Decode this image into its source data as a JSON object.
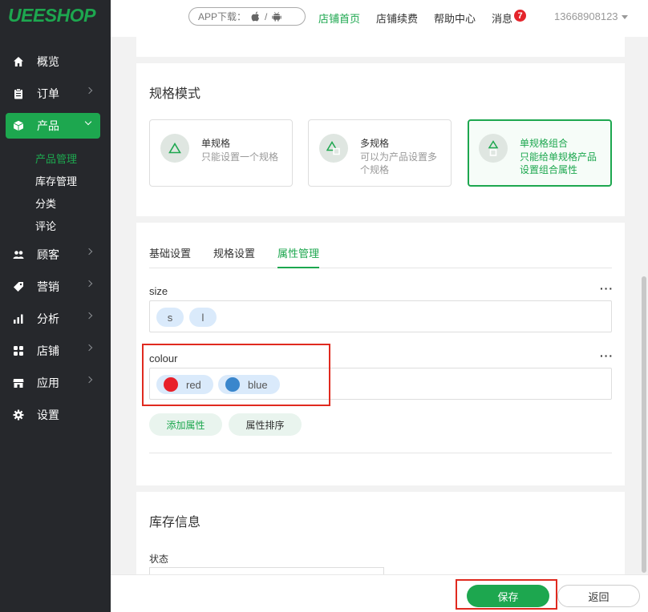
{
  "app": {
    "logo": "UEESHOP"
  },
  "sidebar": {
    "items": [
      {
        "label": "概览",
        "icon": "home-icon"
      },
      {
        "label": "订单",
        "icon": "clipboard-icon"
      },
      {
        "label": "产品",
        "icon": "box-icon"
      },
      {
        "label": "顾客",
        "icon": "users-icon"
      },
      {
        "label": "营销",
        "icon": "tag-icon"
      },
      {
        "label": "分析",
        "icon": "bar-chart-icon"
      },
      {
        "label": "店铺",
        "icon": "grid-icon"
      },
      {
        "label": "应用",
        "icon": "store-icon"
      },
      {
        "label": "设置",
        "icon": "gear-icon"
      }
    ],
    "sub_items": [
      {
        "label": "产品管理"
      },
      {
        "label": "库存管理"
      },
      {
        "label": "分类"
      },
      {
        "label": "评论"
      }
    ]
  },
  "header": {
    "app_download": "APP下载：",
    "slash": "/",
    "links": [
      {
        "label": "店铺首页"
      },
      {
        "label": "店铺续费"
      },
      {
        "label": "帮助中心"
      },
      {
        "label": "消息"
      }
    ],
    "message_count": "7",
    "user": "13668908123"
  },
  "spec_mode": {
    "title": "规格模式",
    "options": [
      {
        "name": "单规格",
        "desc": "只能设置一个规格"
      },
      {
        "name": "多规格",
        "desc": "可以为产品设置多个规格"
      },
      {
        "name": "单规格组合",
        "desc": "只能给单规格产品设置组合属性"
      }
    ]
  },
  "tabs": [
    {
      "label": "基础设置"
    },
    {
      "label": "规格设置"
    },
    {
      "label": "属性管理"
    }
  ],
  "attributes": [
    {
      "name": "size",
      "more": "···",
      "values": [
        {
          "label": "s"
        },
        {
          "label": "l"
        }
      ]
    },
    {
      "name": "colour",
      "more": "···",
      "values": [
        {
          "label": "red",
          "color": "#e8202a"
        },
        {
          "label": "blue",
          "color": "#3a86cc"
        }
      ]
    }
  ],
  "attribute_actions": {
    "add": "添加属性",
    "sort": "属性排序"
  },
  "inventory": {
    "title": "库存信息",
    "status_label": "状态"
  },
  "footer": {
    "save": "保存",
    "back": "返回"
  },
  "colors": {
    "accent": "#1da74f",
    "sidebar_bg": "#26282c",
    "highlight_frame": "#e02a1f",
    "badge": "#e4242b"
  }
}
